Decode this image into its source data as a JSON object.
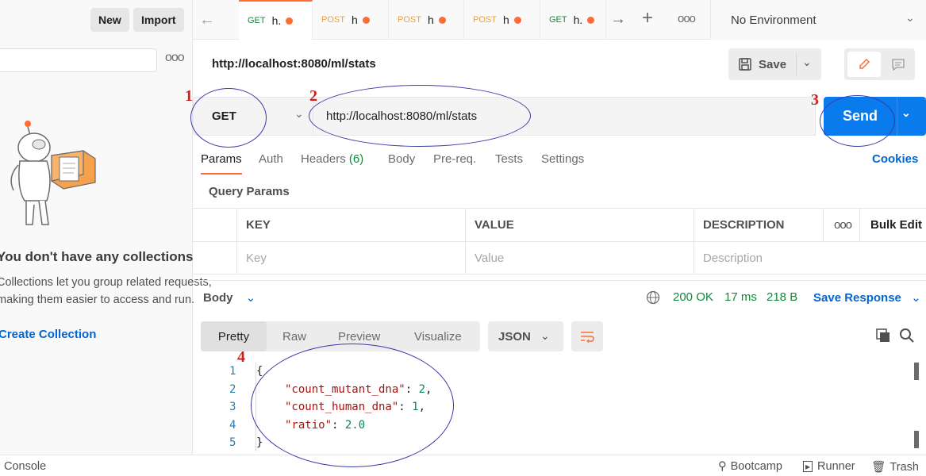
{
  "sidebar": {
    "new_label": "New",
    "import_label": "Import",
    "empty_title": "You don't have any collections",
    "empty_desc_line1": "Collections let you group related requests,",
    "empty_desc_line2": "making them easier to access and run.",
    "create_label": "Create Collection",
    "more_icon": "ooo"
  },
  "tabs": [
    {
      "method": "GET",
      "name": "h.",
      "dirty": true,
      "active": true
    },
    {
      "method": "POST",
      "name": "h",
      "dirty": true
    },
    {
      "method": "POST",
      "name": "h",
      "dirty": true
    },
    {
      "method": "POST",
      "name": "h",
      "dirty": true
    },
    {
      "method": "GET",
      "name": "h.",
      "dirty": true
    }
  ],
  "tabs_more_icon": "ooo",
  "environment": {
    "label": "No Environment"
  },
  "request": {
    "title": "http://localhost:8080/ml/stats",
    "save_label": "Save",
    "method": "GET",
    "url": "http://localhost:8080/ml/stats",
    "send_label": "Send"
  },
  "request_tabs": {
    "params": "Params",
    "auth": "Auth",
    "headers": "Headers",
    "headers_count": "(6)",
    "body": "Body",
    "prereq": "Pre-req.",
    "tests": "Tests",
    "settings": "Settings",
    "cookies": "Cookies"
  },
  "query_params": {
    "label": "Query Params",
    "headers": [
      "KEY",
      "VALUE",
      "DESCRIPTION"
    ],
    "more_icon": "ooo",
    "bulk_edit": "Bulk Edit",
    "placeholders": [
      "Key",
      "Value",
      "Description"
    ]
  },
  "response": {
    "body_label": "Body",
    "status": "200 OK",
    "time": "17 ms",
    "size": "218 B",
    "save_response": "Save Response",
    "views": [
      "Pretty",
      "Raw",
      "Preview",
      "Visualize"
    ],
    "format": "JSON",
    "lines": [
      "1",
      "2",
      "3",
      "4",
      "5"
    ],
    "json": {
      "open": "{",
      "k1": "\"count_mutant_dna\"",
      "v1": "2",
      "k2": "\"count_human_dna\"",
      "v2": "1",
      "k3": "\"ratio\"",
      "v3": "2.0",
      "close": "}"
    }
  },
  "footer": {
    "console": "Console",
    "bootcamp": "Bootcamp",
    "runner": "Runner",
    "trash": "Trash"
  },
  "annotations": [
    "1",
    "2",
    "3",
    "4"
  ],
  "colors": {
    "accent": "#ff6c37",
    "send": "#097bed",
    "link": "#0265d2",
    "annotation": "#d01e1e",
    "ellipse": "#3a3aa8"
  }
}
